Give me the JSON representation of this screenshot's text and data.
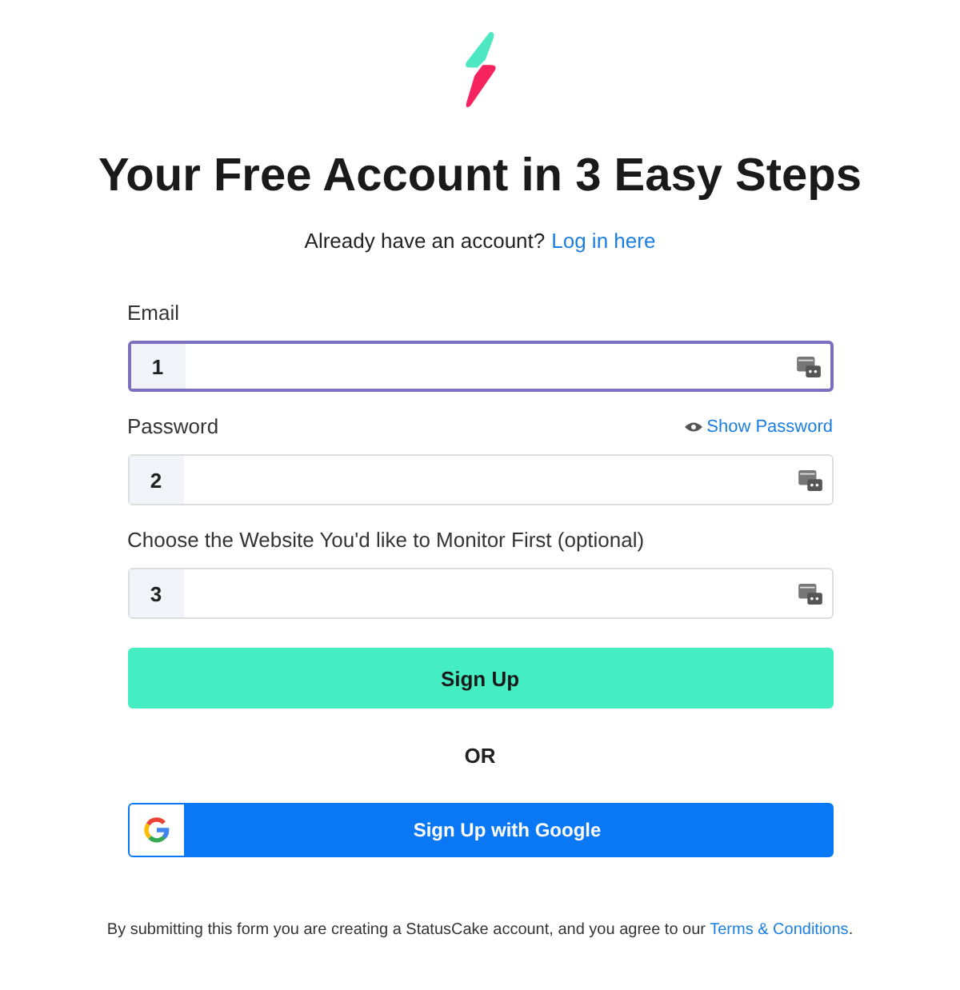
{
  "title": "Your Free Account in 3 Easy Steps",
  "login_prompt": {
    "text": "Already have an account?",
    "link": "Log in here"
  },
  "fields": [
    {
      "label": "Email",
      "step": "1",
      "focused": true
    },
    {
      "label": "Password",
      "step": "2",
      "focused": false,
      "toggle": "Show Password"
    },
    {
      "label": "Choose the Website You'd like to Monitor First (optional)",
      "step": "3",
      "focused": false
    }
  ],
  "submit_button": "Sign Up",
  "divider": "OR",
  "google_button": "Sign Up with Google",
  "footer": {
    "text": "By submitting this form you are creating a StatusCake account, and you agree to our",
    "link": "Terms & Conditions",
    "end": "."
  }
}
